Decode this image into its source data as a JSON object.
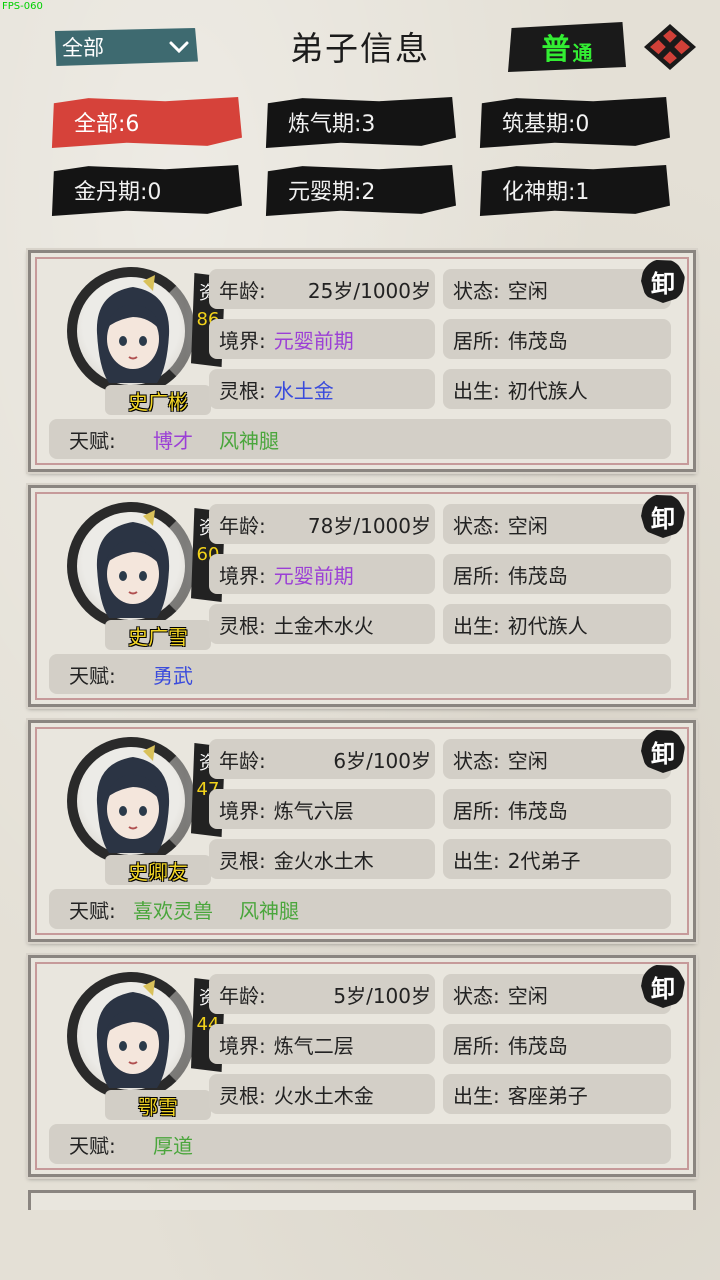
{
  "fps": "FPS-060",
  "header": {
    "dropdown_value": "全部",
    "title": "弟子信息",
    "mode_big": "普",
    "mode_small": "通",
    "close_icon": "close-x-icon"
  },
  "tabs": [
    {
      "label": "全部:6",
      "active": true
    },
    {
      "label": "炼气期:3"
    },
    {
      "label": "筑基期:0"
    },
    {
      "label": "金丹期:0"
    },
    {
      "label": "元婴期:2"
    },
    {
      "label": "化神期:1"
    }
  ],
  "labels": {
    "aptitude": "资",
    "age": "年龄:",
    "state": "状态:",
    "realm": "境界:",
    "home": "居所:",
    "root": "灵根:",
    "birth": "出生:",
    "talent": "天赋:",
    "unload": "卸"
  },
  "colors": {
    "purple": "#9b3fd6",
    "blue": "#3a4bdc",
    "green": "#4aa63c",
    "name_yellow": "#f3d625",
    "active_tab": "#d6423a",
    "mode_green": "#33ee33"
  },
  "disciples": [
    {
      "name": "史广彬",
      "aptitude": "86",
      "age": "25岁/1000岁",
      "state": "空闲",
      "realm": "元婴前期",
      "home": "伟茂岛",
      "root": "水土金",
      "birth": "初代族人",
      "talents": [
        "博才",
        "风神腿"
      ]
    },
    {
      "name": "史广雪",
      "aptitude": "60",
      "age": "78岁/1000岁",
      "state": "空闲",
      "realm": "元婴前期",
      "home": "伟茂岛",
      "root": "土金木水火",
      "birth": "初代族人",
      "talents": [
        "勇武"
      ]
    },
    {
      "name": "史卿友",
      "aptitude": "47",
      "age": "6岁/100岁",
      "state": "空闲",
      "realm": "炼气六层",
      "home": "伟茂岛",
      "root": "金火水土木",
      "birth": "2代弟子",
      "talents": [
        "喜欢灵兽",
        "风神腿"
      ]
    },
    {
      "name": "鄂雪",
      "aptitude": "44",
      "age": "5岁/100岁",
      "state": "空闲",
      "realm": "炼气二层",
      "home": "伟茂岛",
      "root": "火水土木金",
      "birth": "客座弟子",
      "talents": [
        "厚道"
      ]
    }
  ]
}
